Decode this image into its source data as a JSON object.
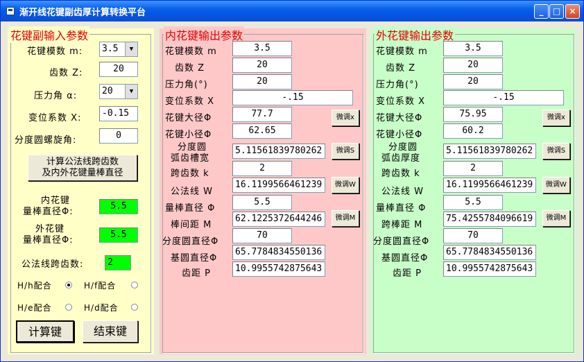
{
  "window": {
    "title": "渐开线花键副齿厚计算转换平台",
    "min": "_",
    "max": "□",
    "close": "×"
  },
  "input": {
    "legend": "花键副输入参数",
    "module_label": "花键模数 m:",
    "module_value": "3.5",
    "teeth_label": "齿数 Z:",
    "teeth_value": "20",
    "pressure_label": "压力角 α:",
    "pressure_value": "20",
    "shift_label": "变位系数 X:",
    "shift_value": "-0.15",
    "helix_label": "分度圆螺旋角:",
    "helix_value": "0",
    "calc_button": [
      "计算公法线跨齿数",
      "及内外花键量棒直径"
    ],
    "inner_rod_label": [
      "内花键",
      "量棒直径Φ:"
    ],
    "inner_rod_value": "5.5",
    "outer_rod_label": [
      "外花键",
      "量棒直径Φ:"
    ],
    "outer_rod_value": "5.5",
    "span_label": "公法线跨齿数:",
    "span_value": "2",
    "fits": [
      {
        "label": "H/h配合",
        "checked": true
      },
      {
        "label": "H/f配合",
        "checked": false
      },
      {
        "label": "H/e配合",
        "checked": false
      },
      {
        "label": "H/d配合",
        "checked": false
      }
    ],
    "compute_button": "计算键",
    "end_button": "结束键"
  },
  "inner": {
    "legend": "内花键输出参数",
    "module_label": "花键模数 m",
    "module_value": "3.5",
    "teeth_label": "齿数 Z",
    "teeth_value": "20",
    "pressure_label": "压力角(°)",
    "pressure_value": "20",
    "shift_label": "变位系数 X",
    "shift_value": "-.15",
    "major_label": "花键大径Φ",
    "major_value": "77.7",
    "minor_label": "花键小径Φ",
    "minor_value": "62.65",
    "arc_label": [
      "分度圆",
      "弧齿槽宽"
    ],
    "arc_value": "5.11561839780262",
    "span_label": "跨齿数 k",
    "span_value": "2",
    "wn_label": "公法线 W",
    "wn_value": "16.1199566461239",
    "rod_label": "量棒直径 Φ",
    "rod_value": "5.5",
    "m_label": "棒间距 M",
    "m_value": "62.1225372644246",
    "pitch_label": "分度圆直径Φ",
    "pitch_value": "70",
    "base_label": "基圆直径Φ",
    "base_value": "65.7784834550136",
    "pb_label": "齿距 P",
    "pb_value": "10.9955742875643",
    "adj": [
      "微调x",
      "微调S",
      "微调W",
      "微调M"
    ]
  },
  "outer": {
    "legend": "外花键输出参数",
    "module_label": "花键模数 m",
    "module_value": "3.5",
    "teeth_label": "齿数 Z",
    "teeth_value": "20",
    "pressure_label": "压力角(°)",
    "pressure_value": "20",
    "shift_label": "变位系数 X",
    "shift_value": "-.15",
    "major_label": "花键大径Φ",
    "major_value": "75.95",
    "minor_label": "花键小径Φ",
    "minor_value": "60.2",
    "arc_label": [
      "分度圆",
      "弧齿厚度"
    ],
    "arc_value": "5.11561839780262",
    "span_label": "跨齿数 k",
    "span_value": "2",
    "wn_label": "公法线 W",
    "wn_value": "16.1199566461239",
    "rod_label": "量棒直径 Φ",
    "rod_value": "5.5",
    "m_label": "跨棒距 M",
    "m_value": "75.4255784096619",
    "pitch_label": "分度圆直径Φ",
    "pitch_value": "70",
    "base_label": "基圆直径Φ",
    "base_value": "65.7784834550136",
    "pb_label": "齿距 P",
    "pb_value": "10.9955742875643",
    "adj": [
      "微调x",
      "微调S",
      "微调W",
      "微调M"
    ]
  }
}
